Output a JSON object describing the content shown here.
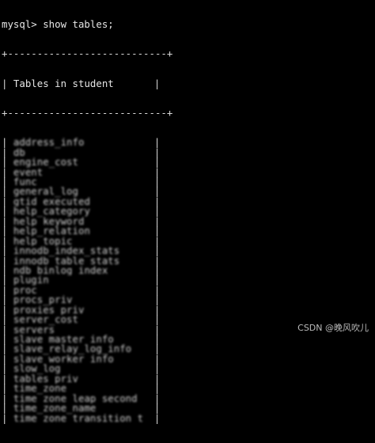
{
  "terminal": {
    "prompt_line": "mysql> show tables;",
    "border_line": "+---------------------------+",
    "header": "Tables_in_student",
    "rows": [
      "address_info",
      "db",
      "engine_cost",
      "event",
      "func",
      "general_log",
      "gtid_executed",
      "help_category",
      "help_keyword",
      "help_relation",
      "help_topic",
      "innodb_index_stats",
      "innodb_table_stats",
      "ndb_binlog_index",
      "plugin",
      "proc",
      "procs_priv",
      "proxies_priv",
      "server_cost",
      "servers",
      "slave_master_info",
      "slave_relay_log_info",
      "slave_worker_info",
      "slow_log",
      "tables_priv",
      "time_zone",
      "time_zone_leap_second",
      "time_zone_name",
      "time_zone_transition_type"
    ]
  },
  "watermark": "CSDN @晚风吹儿"
}
